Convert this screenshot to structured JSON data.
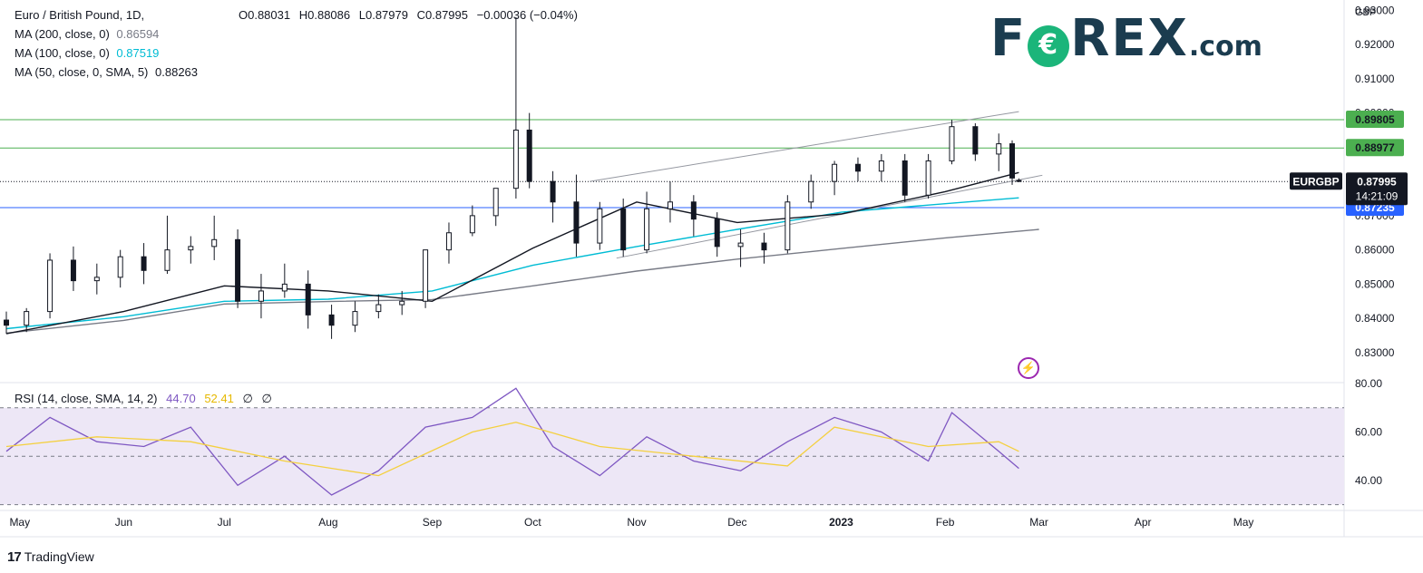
{
  "header": {
    "symbol_title": "Euro / British Pound, 1D,",
    "ohlc": {
      "open": "O0.88031",
      "high": "H0.88086",
      "low": "L0.87979",
      "close": "C0.87995",
      "change": "−0.00036 (−0.04%)"
    },
    "ma200": {
      "label": "MA (200, close, 0)",
      "value": "0.86594",
      "color": "#787b86"
    },
    "ma100": {
      "label": "MA (100, close, 0)",
      "value": "0.87519",
      "color": "#00bcd4"
    },
    "ma50": {
      "label": "MA (50, close, 0, SMA, 5)",
      "value": "0.88263",
      "color": "#131722"
    }
  },
  "logo": {
    "main": "F",
    "rest": "REX",
    "suffix": ".com",
    "icon": "euro-coin-icon"
  },
  "price_labels": {
    "currency": "GBP",
    "level_1": "0.89805",
    "level_2": "0.88977",
    "level_3": "0.87235",
    "symbol": "EURGBP",
    "last": "0.87995",
    "countdown": "14:21:09"
  },
  "rsi_legend": {
    "label": "RSI (14, close, SMA, 14, 2)",
    "rsi_value": "44.70",
    "sma_value": "52.41",
    "extra1": "∅",
    "extra2": "∅"
  },
  "footer": {
    "brand": "TradingView",
    "icon": "tradingview-logo-icon"
  },
  "colors": {
    "up": "#131722",
    "down": "#131722",
    "ma200": "#787b86",
    "ma100": "#00bcd4",
    "ma50": "#131722",
    "hline_green": "#4caf50",
    "hline_blue": "#2962ff",
    "rsi": "#7e57c2",
    "rsi_sma": "#f4d03f",
    "rsi_band": "#ede7f6"
  },
  "chart_data": {
    "type": "candlestick",
    "title": "Euro / British Pound, 1D",
    "y_axis": {
      "unit": "GBP",
      "range": [
        0.8215,
        0.933
      ],
      "ticks": [
        "0.93000",
        "0.92000",
        "0.91000",
        "0.90000",
        "0.89000",
        "0.88000",
        "0.87000",
        "0.86000",
        "0.85000",
        "0.84000",
        "0.83000"
      ]
    },
    "x_axis": {
      "ticks": [
        "May",
        "Jun",
        "Jul",
        "Aug",
        "Sep",
        "Oct",
        "Nov",
        "Dec",
        "2023",
        "Feb",
        "Mar",
        "Apr",
        "May"
      ],
      "range": [
        "2022-04-27",
        "2023-05-31"
      ]
    },
    "horizontal_levels": [
      {
        "price": 0.89805,
        "color": "#4caf50"
      },
      {
        "price": 0.88977,
        "color": "#4caf50"
      },
      {
        "price": 0.87235,
        "color": "#2962ff"
      },
      {
        "price": 0.87995,
        "color": "#131722",
        "style": "dotted"
      }
    ],
    "trend_channel": {
      "upper": [
        {
          "date": "2022-10-18",
          "price": 0.88
        },
        {
          "date": "2023-02-23",
          "price": 0.9004
        }
      ],
      "lower": [
        {
          "date": "2022-10-26",
          "price": 0.8576
        },
        {
          "date": "2023-03-02",
          "price": 0.8818
        }
      ]
    },
    "moving_averages": {
      "ma200": [
        [
          "2022-04-27",
          0.8357
        ],
        [
          "2022-06-01",
          0.8394
        ],
        [
          "2022-07-01",
          0.8442
        ],
        [
          "2022-08-01",
          0.8449
        ],
        [
          "2022-09-01",
          0.8455
        ],
        [
          "2022-10-01",
          0.8495
        ],
        [
          "2022-11-01",
          0.8538
        ],
        [
          "2022-12-01",
          0.8573
        ],
        [
          "2023-01-01",
          0.8604
        ],
        [
          "2023-02-01",
          0.8635
        ],
        [
          "2023-03-01",
          0.866
        ]
      ],
      "ma100": [
        [
          "2022-04-27",
          0.837
        ],
        [
          "2022-06-01",
          0.8405
        ],
        [
          "2022-07-01",
          0.845
        ],
        [
          "2022-08-01",
          0.8456
        ],
        [
          "2022-09-01",
          0.848
        ],
        [
          "2022-10-01",
          0.8555
        ],
        [
          "2022-11-01",
          0.861
        ],
        [
          "2022-12-01",
          0.866
        ],
        [
          "2023-01-01",
          0.871
        ],
        [
          "2023-02-01",
          0.8735
        ],
        [
          "2023-02-23",
          0.8752
        ]
      ],
      "ma50": [
        [
          "2022-04-27",
          0.8355
        ],
        [
          "2022-06-01",
          0.842
        ],
        [
          "2022-07-01",
          0.8495
        ],
        [
          "2022-08-01",
          0.848
        ],
        [
          "2022-09-01",
          0.845
        ],
        [
          "2022-10-01",
          0.8605
        ],
        [
          "2022-11-01",
          0.874
        ],
        [
          "2022-12-01",
          0.868
        ],
        [
          "2023-01-01",
          0.8705
        ],
        [
          "2023-02-01",
          0.877
        ],
        [
          "2023-02-23",
          0.8826
        ]
      ]
    },
    "candles": [
      [
        "2022-04-27",
        0.8395,
        0.842,
        0.8355,
        0.838
      ],
      [
        "2022-05-03",
        0.838,
        0.843,
        0.836,
        0.842
      ],
      [
        "2022-05-10",
        0.842,
        0.859,
        0.84,
        0.857
      ],
      [
        "2022-05-17",
        0.857,
        0.861,
        0.848,
        0.851
      ],
      [
        "2022-05-24",
        0.851,
        0.856,
        0.847,
        0.852
      ],
      [
        "2022-05-31",
        0.852,
        0.86,
        0.849,
        0.858
      ],
      [
        "2022-06-07",
        0.858,
        0.862,
        0.85,
        0.854
      ],
      [
        "2022-06-14",
        0.854,
        0.87,
        0.853,
        0.86
      ],
      [
        "2022-06-21",
        0.86,
        0.864,
        0.856,
        0.861
      ],
      [
        "2022-06-28",
        0.861,
        0.87,
        0.857,
        0.863
      ],
      [
        "2022-07-05",
        0.863,
        0.866,
        0.843,
        0.845
      ],
      [
        "2022-07-12",
        0.845,
        0.853,
        0.84,
        0.848
      ],
      [
        "2022-07-19",
        0.848,
        0.856,
        0.846,
        0.85
      ],
      [
        "2022-07-26",
        0.85,
        0.854,
        0.837,
        0.841
      ],
      [
        "2022-08-02",
        0.841,
        0.844,
        0.834,
        0.838
      ],
      [
        "2022-08-09",
        0.838,
        0.845,
        0.836,
        0.842
      ],
      [
        "2022-08-16",
        0.842,
        0.847,
        0.84,
        0.844
      ],
      [
        "2022-08-23",
        0.844,
        0.848,
        0.841,
        0.845
      ],
      [
        "2022-08-30",
        0.845,
        0.86,
        0.843,
        0.86
      ],
      [
        "2022-09-06",
        0.86,
        0.868,
        0.856,
        0.865
      ],
      [
        "2022-09-13",
        0.865,
        0.873,
        0.864,
        0.87
      ],
      [
        "2022-09-20",
        0.87,
        0.878,
        0.867,
        0.878
      ],
      [
        "2022-09-26",
        0.878,
        0.928,
        0.875,
        0.895
      ],
      [
        "2022-09-30",
        0.895,
        0.9,
        0.878,
        0.88
      ],
      [
        "2022-10-07",
        0.88,
        0.883,
        0.868,
        0.874
      ],
      [
        "2022-10-14",
        0.874,
        0.882,
        0.858,
        0.862
      ],
      [
        "2022-10-21",
        0.862,
        0.874,
        0.86,
        0.872
      ],
      [
        "2022-10-28",
        0.872,
        0.875,
        0.858,
        0.86
      ],
      [
        "2022-11-04",
        0.86,
        0.877,
        0.859,
        0.872
      ],
      [
        "2022-11-11",
        0.872,
        0.88,
        0.868,
        0.874
      ],
      [
        "2022-11-18",
        0.874,
        0.876,
        0.864,
        0.869
      ],
      [
        "2022-11-25",
        0.869,
        0.871,
        0.858,
        0.861
      ],
      [
        "2022-12-02",
        0.861,
        0.866,
        0.855,
        0.862
      ],
      [
        "2022-12-09",
        0.862,
        0.865,
        0.856,
        0.86
      ],
      [
        "2022-12-16",
        0.86,
        0.876,
        0.859,
        0.874
      ],
      [
        "2022-12-23",
        0.874,
        0.882,
        0.872,
        0.88
      ],
      [
        "2022-12-30",
        0.88,
        0.886,
        0.876,
        0.885
      ],
      [
        "2023-01-06",
        0.885,
        0.887,
        0.88,
        0.883
      ],
      [
        "2023-01-13",
        0.883,
        0.888,
        0.88,
        0.886
      ],
      [
        "2023-01-20",
        0.886,
        0.888,
        0.874,
        0.876
      ],
      [
        "2023-01-27",
        0.876,
        0.888,
        0.875,
        0.886
      ],
      [
        "2023-02-03",
        0.886,
        0.898,
        0.885,
        0.896
      ],
      [
        "2023-02-10",
        0.896,
        0.897,
        0.886,
        0.888
      ],
      [
        "2023-02-17",
        0.888,
        0.894,
        0.883,
        0.891
      ],
      [
        "2023-02-21",
        0.891,
        0.892,
        0.879,
        0.881
      ],
      [
        "2023-02-23",
        0.8803,
        0.8809,
        0.8798,
        0.88
      ]
    ],
    "rsi_panel": {
      "label": "RSI (14, close, SMA, 14, 2)",
      "ticks": [
        "80.00",
        "60.00",
        "40.00"
      ],
      "range": [
        28,
        80
      ],
      "bands": [
        30,
        50,
        70
      ],
      "rsi": [
        [
          "2022-04-27",
          52
        ],
        [
          "2022-05-10",
          66
        ],
        [
          "2022-05-24",
          56
        ],
        [
          "2022-06-07",
          54
        ],
        [
          "2022-06-21",
          62
        ],
        [
          "2022-07-05",
          38
        ],
        [
          "2022-07-19",
          50
        ],
        [
          "2022-08-02",
          34
        ],
        [
          "2022-08-16",
          44
        ],
        [
          "2022-08-30",
          62
        ],
        [
          "2022-09-13",
          66
        ],
        [
          "2022-09-26",
          78
        ],
        [
          "2022-10-07",
          54
        ],
        [
          "2022-10-21",
          42
        ],
        [
          "2022-11-04",
          58
        ],
        [
          "2022-11-18",
          48
        ],
        [
          "2022-12-02",
          44
        ],
        [
          "2022-12-16",
          56
        ],
        [
          "2022-12-30",
          66
        ],
        [
          "2023-01-13",
          60
        ],
        [
          "2023-01-27",
          48
        ],
        [
          "2023-02-03",
          68
        ],
        [
          "2023-02-17",
          52
        ],
        [
          "2023-02-23",
          45
        ]
      ],
      "rsi_sma": [
        [
          "2022-04-27",
          54
        ],
        [
          "2022-05-24",
          58
        ],
        [
          "2022-06-21",
          56
        ],
        [
          "2022-07-19",
          48
        ],
        [
          "2022-08-16",
          42
        ],
        [
          "2022-09-13",
          60
        ],
        [
          "2022-09-26",
          64
        ],
        [
          "2022-10-21",
          54
        ],
        [
          "2022-11-18",
          50
        ],
        [
          "2022-12-16",
          46
        ],
        [
          "2022-12-30",
          62
        ],
        [
          "2023-01-27",
          54
        ],
        [
          "2023-02-17",
          56
        ],
        [
          "2023-02-23",
          52
        ]
      ]
    }
  }
}
